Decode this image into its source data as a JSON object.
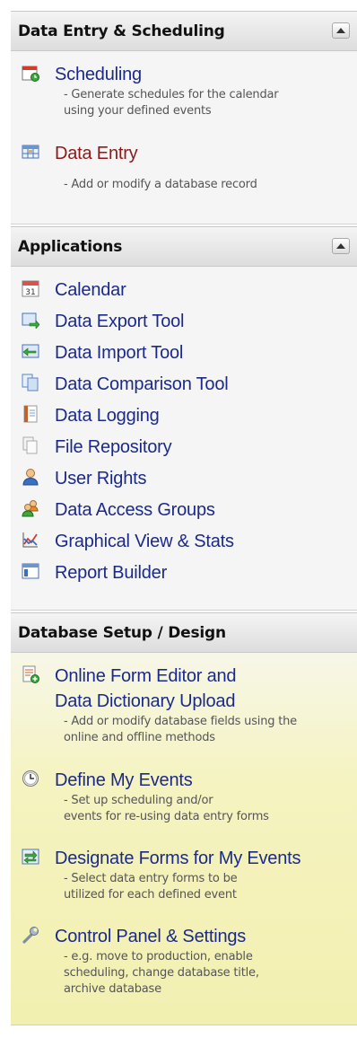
{
  "sections": {
    "data_entry": {
      "title": "Data Entry & Scheduling",
      "items": [
        {
          "label": "Scheduling",
          "desc1": "- Generate schedules for the calendar",
          "desc2": "using your defined events"
        },
        {
          "label": "Data Entry",
          "desc1": "- Add or modify a database record"
        }
      ]
    },
    "applications": {
      "title": "Applications",
      "items": [
        {
          "label": "Calendar"
        },
        {
          "label": "Data Export Tool"
        },
        {
          "label": "Data Import Tool"
        },
        {
          "label": "Data Comparison Tool"
        },
        {
          "label": "Data Logging"
        },
        {
          "label": "File Repository"
        },
        {
          "label": "User Rights"
        },
        {
          "label": "Data Access Groups"
        },
        {
          "label": "Graphical View & Stats"
        },
        {
          "label": "Report Builder"
        }
      ]
    },
    "db_setup": {
      "title": "Database Setup / Design",
      "items": [
        {
          "label1": "Online Form Editor and",
          "label2": "Data Dictionary Upload",
          "desc1": "- Add or modify database fields using the",
          "desc2": "online and offline methods"
        },
        {
          "label": "Define My Events",
          "desc1": "- Set up scheduling and/or",
          "desc2": "events for re-using data entry forms"
        },
        {
          "label": "Designate Forms for My Events",
          "desc1": "- Select data entry forms to be",
          "desc2": "utilized for each defined event"
        },
        {
          "label": "Control Panel & Settings",
          "desc1": "- e.g. move to production, enable",
          "desc2": "scheduling, change database title,",
          "desc3": "archive database"
        }
      ]
    }
  },
  "icons": {
    "scheduling": "calendar-clock-icon",
    "data_entry": "table-grid-icon",
    "calendar": "calendar-icon",
    "export": "export-arrow-icon",
    "import": "import-arrow-icon",
    "comparison": "documents-compare-icon",
    "logging": "log-book-icon",
    "repository": "file-stack-icon",
    "user_rights": "user-icon",
    "access_groups": "user-group-icon",
    "graphical": "chart-icon",
    "report": "report-form-icon",
    "form_editor": "form-add-icon",
    "events": "clock-icon",
    "designate": "designate-arrows-icon",
    "control_panel": "wrench-icon"
  },
  "colors": {
    "link": "#1b2a8a",
    "link_active": "#8a1a1a",
    "setup_background": "#f2f0b0"
  }
}
